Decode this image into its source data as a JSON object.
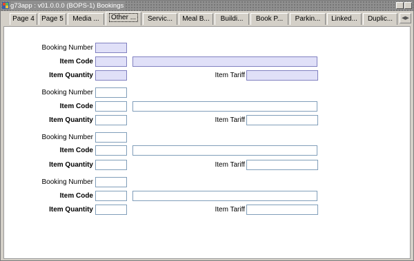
{
  "window": {
    "title": "g73app : v01.0.0.0 (BOPS-1) Bookings"
  },
  "tabs": [
    {
      "label": "Page 4",
      "active": false
    },
    {
      "label": "Page 5",
      "active": false
    },
    {
      "label": "Media ...",
      "active": false
    },
    {
      "label": "Other ...",
      "active": true
    },
    {
      "label": "Servic...",
      "active": false
    },
    {
      "label": "Meal B...",
      "active": false
    },
    {
      "label": "Buildi...",
      "active": false
    },
    {
      "label": "Book P...",
      "active": false
    },
    {
      "label": "Parkin...",
      "active": false
    },
    {
      "label": "Linked...",
      "active": false
    },
    {
      "label": "Duplic...",
      "active": false
    }
  ],
  "tab_scroll_icon": "left-right-arrows-icon",
  "labels": {
    "booking_number": "Booking Number",
    "item_code": "Item Code",
    "item_quantity": "Item Quantity",
    "item_tariff": "Item Tariff"
  },
  "records": [
    {
      "booking_number": "",
      "item_code": "",
      "item_description": "",
      "item_quantity": "",
      "item_tariff": "",
      "highlighted": true
    },
    {
      "booking_number": "",
      "item_code": "",
      "item_description": "",
      "item_quantity": "",
      "item_tariff": "",
      "highlighted": false
    },
    {
      "booking_number": "",
      "item_code": "",
      "item_description": "",
      "item_quantity": "",
      "item_tariff": "",
      "highlighted": false
    },
    {
      "booking_number": "",
      "item_code": "",
      "item_description": "",
      "item_quantity": "",
      "item_tariff": "",
      "highlighted": false
    }
  ],
  "colors": {
    "highlight_field": "#e0e0f8",
    "tab_bg": "#d4d0c8"
  }
}
